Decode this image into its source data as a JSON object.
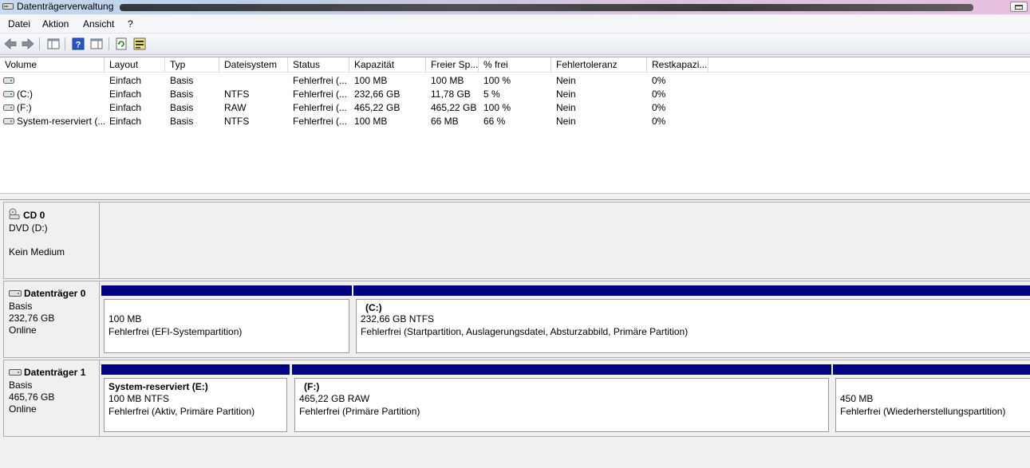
{
  "window": {
    "title": "Datenträgerverwaltung"
  },
  "menu": [
    "Datei",
    "Aktion",
    "Ansicht",
    "?"
  ],
  "toolbar_icons": [
    "back-arrow-icon",
    "forward-arrow-icon",
    "console-tree-icon",
    "help-icon",
    "properties-icon",
    "refresh-icon",
    "disk-settings-icon"
  ],
  "volume_table": {
    "columns": [
      "Volume",
      "Layout",
      "Typ",
      "Dateisystem",
      "Status",
      "Kapazität",
      "Freier Sp...",
      "% frei",
      "Fehlertoleranz",
      "Restkapazi..."
    ],
    "rows": [
      [
        "",
        "Einfach",
        "Basis",
        "",
        "Fehlerfrei (...",
        "100 MB",
        "100 MB",
        "100 %",
        "Nein",
        "0%"
      ],
      [
        "(C:)",
        "Einfach",
        "Basis",
        "NTFS",
        "Fehlerfrei (...",
        "232,66 GB",
        "11,78 GB",
        "5 %",
        "Nein",
        "0%"
      ],
      [
        "(F:)",
        "Einfach",
        "Basis",
        "RAW",
        "Fehlerfrei (...",
        "465,22 GB",
        "465,22 GB",
        "100 %",
        "Nein",
        "0%"
      ],
      [
        "System-reserviert (...",
        "Einfach",
        "Basis",
        "NTFS",
        "Fehlerfrei (...",
        "100 MB",
        "66 MB",
        "66 %",
        "Nein",
        "0%"
      ]
    ]
  },
  "cd": {
    "name": "CD 0",
    "type": "DVD (D:)",
    "status": "Kein Medium"
  },
  "disk0": {
    "name": "Datenträger 0",
    "type": "Basis",
    "size": "232,76 GB",
    "state": "Online",
    "p1": {
      "size": "100 MB",
      "status": "Fehlerfrei (EFI-Systempartition)"
    },
    "p2": {
      "name": "(C:)",
      "size": "232,66 GB NTFS",
      "status": "Fehlerfrei (Startpartition, Auslagerungsdatei, Absturzabbild, Primäre Partition)"
    }
  },
  "disk1": {
    "name": "Datenträger 1",
    "type": "Basis",
    "size": "465,76 GB",
    "state": "Online",
    "p1": {
      "name": "System-reserviert  (E:)",
      "size": "100 MB NTFS",
      "status": "Fehlerfrei (Aktiv, Primäre Partition)"
    },
    "p2": {
      "name": "(F:)",
      "size": "465,22 GB RAW",
      "status": "Fehlerfrei (Primäre Partition)"
    },
    "p3": {
      "size": "450 MB",
      "status": "Fehlerfrei (Wiederherstellungspartition)"
    }
  },
  "colors": {
    "partition_bar": "#000080"
  }
}
